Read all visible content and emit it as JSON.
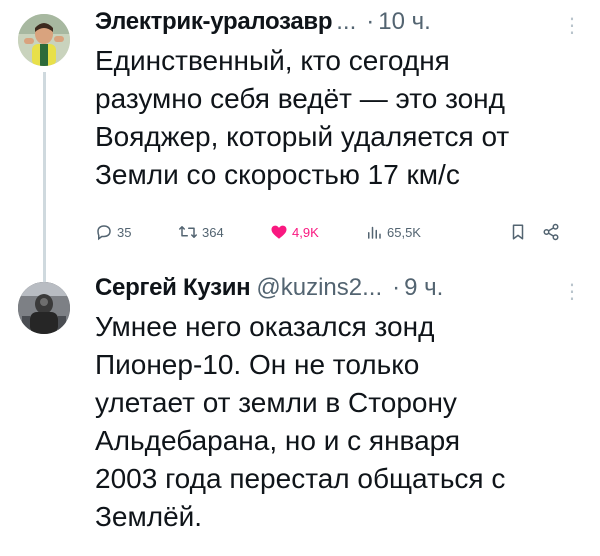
{
  "tweets": [
    {
      "author_name": "Электрик-уралозавр",
      "handle": "",
      "ellipsis": "...",
      "separator": "·",
      "time": "10 ч.",
      "more_icon": "more-icon",
      "lines": [
        "Единственный, кто сегодня",
        "разумно себя ведёт — это зонд",
        "Вояджер, который удаляется от",
        "Земли со скоростью 17 км/с"
      ],
      "stats": {
        "replies": "35",
        "retweets": "364",
        "likes": "4,9K",
        "views": "65,5K"
      }
    },
    {
      "author_name": "Сергей Кузин",
      "handle": "@kuzins2...",
      "ellipsis": "",
      "separator": "·",
      "time": "9 ч.",
      "more_icon": "more-icon",
      "lines": [
        "Умнее него оказался зонд",
        "Пионер-10. Он не только",
        "улетает от земли в Сторону",
        "Альдебарана,  но и с января",
        "2003 года перестал общаться с",
        "Землёй."
      ]
    }
  ],
  "colors": {
    "text": "#0f1419",
    "secondary": "#536471",
    "like": "#f91880",
    "thread_line": "#cfd9de"
  },
  "icons": [
    "reply-icon",
    "retweet-icon",
    "like-icon",
    "views-icon",
    "bookmark-icon",
    "share-icon"
  ]
}
